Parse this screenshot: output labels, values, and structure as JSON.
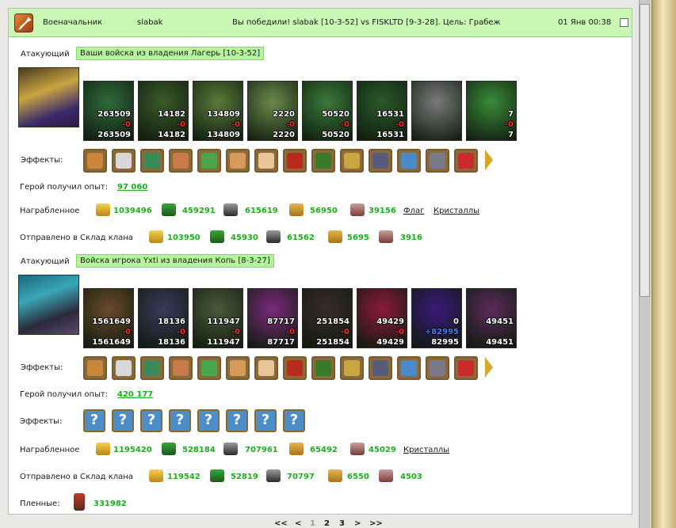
{
  "header": {
    "title_role": "Военачальник",
    "player": "slabak",
    "battle_text": "Вы победили! slabak [10-3-52] vs FISKLTD [9-3-28]. Цель: Грабеж",
    "datetime": "01 Янв 00:38",
    "icon": "sword-icon",
    "bg_color": "#c8f8b4"
  },
  "attacker1": {
    "label": "Атакующий",
    "source": "Ваши войска из владения Лагерь [10-3-52]",
    "units": [
      {
        "icon": "green-knight-unit",
        "count": "263509",
        "lost": "-0",
        "left": "263509"
      },
      {
        "icon": "elf-swordsman-unit",
        "count": "14182",
        "lost": "-0",
        "left": "14182"
      },
      {
        "icon": "elf-spearman-unit",
        "count": "134809",
        "lost": "-0",
        "left": "134809"
      },
      {
        "icon": "griffin-unit",
        "count": "2220",
        "lost": "-0",
        "left": "2220"
      },
      {
        "icon": "elf-archer-unit",
        "count": "50520",
        "lost": "-0",
        "left": "50520"
      },
      {
        "icon": "elf-mage-unit",
        "count": "16531",
        "lost": "-0",
        "left": "16531"
      },
      {
        "icon": "stone-golem-unit",
        "count": "",
        "lost": "",
        "left": ""
      },
      {
        "icon": "druid-unit",
        "count": "7",
        "lost": "-0",
        "left": "7"
      }
    ],
    "effects_label": "Эффекты:",
    "exp_label": "Герой получил опыт:",
    "exp_value": "97 060",
    "loot_label": "Награбленное",
    "loot": [
      {
        "icon": "gold-icon",
        "value": "1039496"
      },
      {
        "icon": "wood-icon",
        "value": "459291"
      },
      {
        "icon": "ore-icon",
        "value": "615619"
      },
      {
        "icon": "grain-icon",
        "value": "56950"
      },
      {
        "icon": "stone-icon",
        "value": "39156"
      }
    ],
    "loot_links": [
      "Флаг",
      "Кристаллы"
    ],
    "clan_label": "Отправлено в Склад клана",
    "clan": [
      {
        "icon": "gold-icon",
        "value": "103950"
      },
      {
        "icon": "wood-icon",
        "value": "45930"
      },
      {
        "icon": "ore-icon",
        "value": "61562"
      },
      {
        "icon": "grain-icon",
        "value": "5695"
      },
      {
        "icon": "stone-icon",
        "value": "3916"
      }
    ]
  },
  "attacker2": {
    "label": "Атакующий",
    "source": "Войска игрока Yxti из владения Копь [8-3-27]",
    "units": [
      {
        "icon": "ogre-unit",
        "count": "1561649",
        "lost": "-0",
        "left": "1561649"
      },
      {
        "icon": "dark-assassin-unit",
        "count": "18136",
        "lost": "-0",
        "left": "18136"
      },
      {
        "icon": "lizard-rider-unit",
        "count": "111947",
        "lost": "-0",
        "left": "111947"
      },
      {
        "icon": "dark-dragon-unit",
        "count": "87717",
        "lost": "-0",
        "left": "87717"
      },
      {
        "icon": "dark-archer-unit",
        "count": "251854",
        "lost": "-0",
        "left": "251854"
      },
      {
        "icon": "warlock-unit",
        "count": "49429",
        "lost": "-0",
        "left": "49429"
      },
      {
        "icon": "sorceress-unit",
        "count": "0",
        "lost": "+82995",
        "left": "82995"
      },
      {
        "icon": "dark-spider-unit",
        "count": "49451",
        "lost": "",
        "left": "49451"
      }
    ],
    "effects_label": "Эффекты:",
    "exp_label": "Герой получил опыт:",
    "exp_value": "420 177",
    "effects2_label": "Эффекты:",
    "unknown_effects": [
      "?",
      "?",
      "?",
      "?",
      "?",
      "?",
      "?",
      "?"
    ],
    "loot_label": "Награбленное",
    "loot": [
      {
        "icon": "gold-icon",
        "value": "1195420"
      },
      {
        "icon": "wood-icon",
        "value": "528184"
      },
      {
        "icon": "ore-icon",
        "value": "707961"
      },
      {
        "icon": "grain-icon",
        "value": "65492"
      },
      {
        "icon": "stone-icon",
        "value": "45029"
      }
    ],
    "loot_links": [
      "Кристаллы"
    ],
    "clan_label": "Отправлено в Склад клана",
    "clan": [
      {
        "icon": "gold-icon",
        "value": "119542"
      },
      {
        "icon": "wood-icon",
        "value": "52819"
      },
      {
        "icon": "ore-icon",
        "value": "70797"
      },
      {
        "icon": "grain-icon",
        "value": "6550"
      },
      {
        "icon": "stone-icon",
        "value": "4503"
      }
    ],
    "prisoners_label": "Пленные:",
    "prisoners_icon": "prisoner-icon",
    "prisoners_value": "331982"
  },
  "pagination": {
    "first": "<<",
    "prev": "<",
    "pages": [
      "1",
      "2",
      "3"
    ],
    "current": "1",
    "next": ">",
    "last": ">>"
  }
}
